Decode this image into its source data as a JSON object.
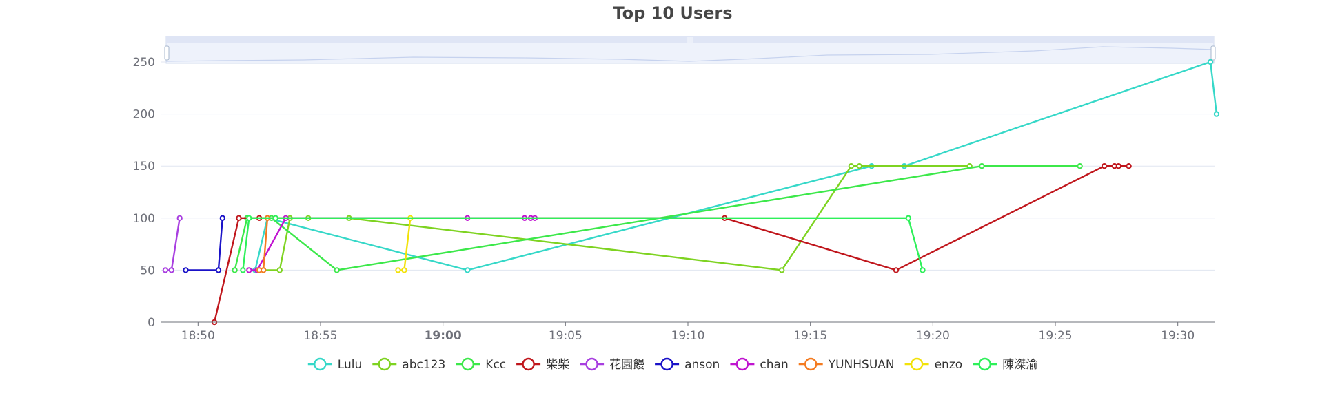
{
  "chart_data": {
    "type": "line",
    "title": "Top 10 Users",
    "xlabel": "",
    "ylabel": "",
    "x_axis": {
      "type": "time",
      "range": [
        "18:48:30",
        "19:31:30"
      ],
      "ticks": [
        "18:50",
        "18:55",
        "19:00",
        "19:05",
        "19:10",
        "19:15",
        "19:20",
        "19:25",
        "19:30"
      ],
      "bold_ticks": [
        "19:00"
      ]
    },
    "y_axis": {
      "range": [
        0,
        250
      ],
      "ticks": [
        0,
        50,
        100,
        150,
        200,
        250
      ]
    },
    "grid": true,
    "legend_position": "bottom",
    "data_zoom_slider": true,
    "series": [
      {
        "name": "Lulu",
        "color": "#36d8c8",
        "points": [
          [
            "18:52:20",
            50
          ],
          [
            "18:52:50",
            100
          ],
          [
            "19:01:00",
            50
          ],
          [
            "19:17:30",
            150
          ],
          [
            "19:18:50",
            150
          ],
          [
            "19:31:20",
            250
          ],
          [
            "19:31:35",
            200
          ]
        ]
      },
      {
        "name": "abc123",
        "color": "#7ed321",
        "points": [
          [
            "18:52:40",
            50
          ],
          [
            "18:53:20",
            50
          ],
          [
            "18:53:45",
            100
          ],
          [
            "18:54:30",
            100
          ],
          [
            "18:56:10",
            100
          ],
          [
            "19:13:50",
            50
          ],
          [
            "19:16:40",
            150
          ],
          [
            "19:17:00",
            150
          ],
          [
            "19:21:30",
            150
          ]
        ]
      },
      {
        "name": "Kcc",
        "color": "#3ce84a",
        "points": [
          [
            "18:51:30",
            50
          ],
          [
            "18:52:00",
            100
          ],
          [
            "18:53:00",
            100
          ],
          [
            "18:55:40",
            50
          ],
          [
            "19:22:00",
            150
          ],
          [
            "19:26:00",
            150
          ]
        ]
      },
      {
        "name": "柴柴",
        "color": "#c0161c",
        "points": [
          [
            "18:50:40",
            0
          ],
          [
            "18:51:40",
            100
          ],
          [
            "18:52:30",
            100
          ],
          [
            "19:11:30",
            100
          ],
          [
            "19:18:30",
            50
          ],
          [
            "19:27:00",
            150
          ],
          [
            "19:27:25",
            150
          ],
          [
            "19:27:35",
            150
          ],
          [
            "19:28:00",
            150
          ]
        ]
      },
      {
        "name": "花園饅",
        "color": "#a83ee0",
        "points": [
          [
            "18:48:40",
            50
          ],
          [
            "18:48:55",
            50
          ],
          [
            "18:49:15",
            100
          ]
        ]
      },
      {
        "name": "anson",
        "color": "#1a12c8",
        "points": [
          [
            "18:49:30",
            50
          ],
          [
            "18:50:50",
            50
          ],
          [
            "18:51:00",
            100
          ]
        ]
      },
      {
        "name": "chan",
        "color": "#c014d0",
        "points": [
          [
            "18:52:05",
            50
          ],
          [
            "18:52:25",
            50
          ],
          [
            "18:53:35",
            100
          ],
          [
            "19:01:00",
            100
          ],
          [
            "19:03:20",
            100
          ],
          [
            "19:03:35",
            100
          ],
          [
            "19:03:45",
            100
          ]
        ]
      },
      {
        "name": "YUNHSUAN",
        "color": "#f47b20",
        "points": [
          [
            "18:52:30",
            50
          ],
          [
            "18:52:40",
            50
          ],
          [
            "18:52:50",
            100
          ]
        ]
      },
      {
        "name": "enzo",
        "color": "#f2e20a",
        "points": [
          [
            "18:58:10",
            50
          ],
          [
            "18:58:25",
            50
          ],
          [
            "18:58:40",
            100
          ]
        ]
      },
      {
        "name": "陳滐渝",
        "color": "#2ef05a",
        "points": [
          [
            "18:51:50",
            50
          ],
          [
            "18:52:05",
            100
          ],
          [
            "18:53:10",
            100
          ],
          [
            "19:19:00",
            100
          ],
          [
            "19:19:35",
            50
          ]
        ]
      }
    ]
  }
}
